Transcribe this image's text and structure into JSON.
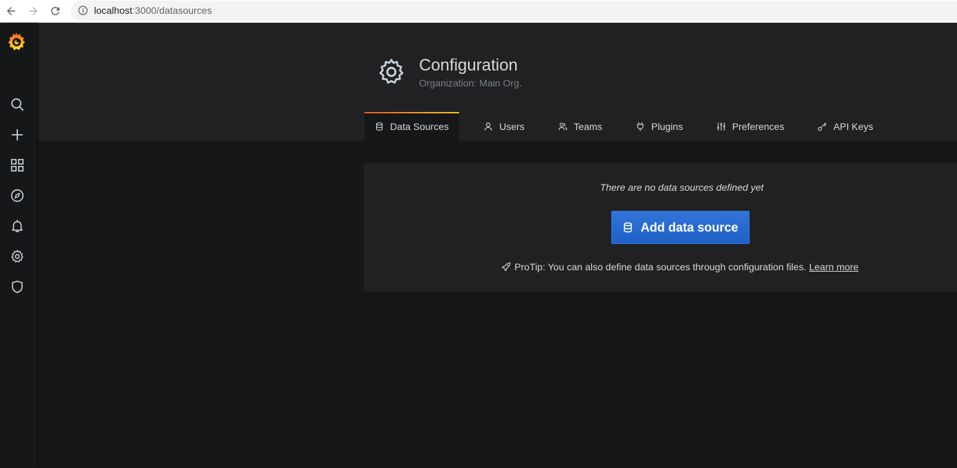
{
  "browser": {
    "url_host": "localhost",
    "url_path": ":3000/datasources",
    "icons": [
      "back-arrow-icon",
      "forward-arrow-icon",
      "reload-icon",
      "info-icon"
    ]
  },
  "sidebar": {
    "items": [
      {
        "name": "search",
        "icon": "search-icon"
      },
      {
        "name": "create",
        "icon": "plus-icon"
      },
      {
        "name": "dashboards",
        "icon": "grid-icon"
      },
      {
        "name": "explore",
        "icon": "compass-icon"
      },
      {
        "name": "alerting",
        "icon": "bell-icon"
      },
      {
        "name": "configuration",
        "icon": "gear-icon"
      },
      {
        "name": "server-admin",
        "icon": "shield-icon"
      }
    ]
  },
  "header": {
    "title": "Configuration",
    "subtitle": "Organization: Main Org."
  },
  "tabs": [
    {
      "label": "Data Sources",
      "icon": "database-icon",
      "active": true
    },
    {
      "label": "Users",
      "icon": "user-icon",
      "active": false
    },
    {
      "label": "Teams",
      "icon": "users-icon",
      "active": false
    },
    {
      "label": "Plugins",
      "icon": "plug-icon",
      "active": false
    },
    {
      "label": "Preferences",
      "icon": "sliders-icon",
      "active": false
    },
    {
      "label": "API Keys",
      "icon": "key-icon",
      "active": false
    }
  ],
  "empty_state": {
    "message": "There are no data sources defined yet",
    "button_label": "Add data source",
    "protip": "ProTip: You can also define data sources through configuration files.",
    "protip_link": "Learn more"
  },
  "colors": {
    "accent_blue": "#1f60c4",
    "tab_gradient_start": "#f05a28",
    "tab_gradient_end": "#fbca0a",
    "panel_bg": "#212124",
    "page_bg": "#161719"
  }
}
